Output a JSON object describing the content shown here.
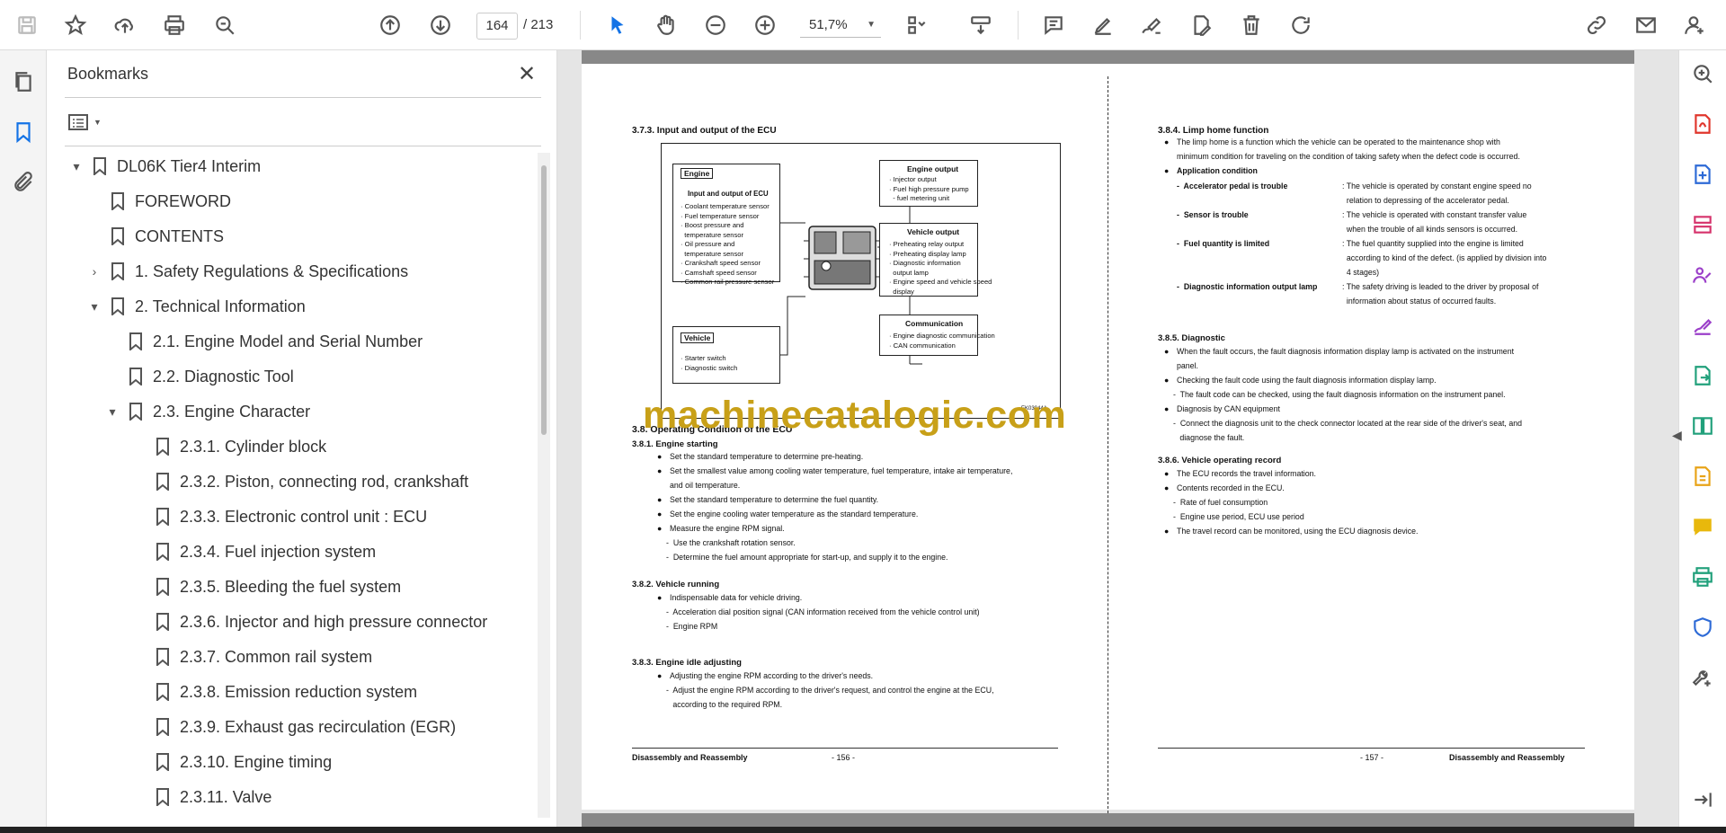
{
  "toolbar": {
    "current_page": "164",
    "total_pages": "/ 213",
    "zoom": "51,7%"
  },
  "bookmarks": {
    "title": "Bookmarks",
    "close_glyph": "✕",
    "items": [
      {
        "label": "DL06K Tier4 Interim",
        "level": 0,
        "toggle": "▾"
      },
      {
        "label": "FOREWORD",
        "level": 1,
        "toggle": ""
      },
      {
        "label": "CONTENTS",
        "level": 1,
        "toggle": ""
      },
      {
        "label": "1. Safety Regulations & Specifications",
        "level": 1,
        "toggle": "›"
      },
      {
        "label": "2. Technical Information",
        "level": 1,
        "toggle": "▾"
      },
      {
        "label": "2.1. Engine Model and Serial Number",
        "level": 2,
        "toggle": ""
      },
      {
        "label": "2.2. Diagnostic Tool",
        "level": 2,
        "toggle": ""
      },
      {
        "label": "2.3. Engine Character",
        "level": 2,
        "toggle": "▾"
      },
      {
        "label": "2.3.1. Cylinder block",
        "level": 3,
        "toggle": ""
      },
      {
        "label": "2.3.2. Piston, connecting rod, crankshaft",
        "level": 3,
        "toggle": ""
      },
      {
        "label": "2.3.3. Electronic control unit : ECU",
        "level": 3,
        "toggle": ""
      },
      {
        "label": "2.3.4. Fuel injection system",
        "level": 3,
        "toggle": ""
      },
      {
        "label": "2.3.5. Bleeding the fuel system",
        "level": 3,
        "toggle": ""
      },
      {
        "label": "2.3.6. Injector and high pressure connector",
        "level": 3,
        "toggle": ""
      },
      {
        "label": "2.3.7. Common rail system",
        "level": 3,
        "toggle": ""
      },
      {
        "label": "2.3.8. Emission reduction system",
        "level": 3,
        "toggle": ""
      },
      {
        "label": "2.3.9. Exhaust gas recirculation (EGR)",
        "level": 3,
        "toggle": ""
      },
      {
        "label": "2.3.10. Engine timing",
        "level": 3,
        "toggle": ""
      },
      {
        "label": "2.3.11. Valve",
        "level": 3,
        "toggle": ""
      }
    ]
  },
  "doc": {
    "watermark": "machinecatalogic.com",
    "left": {
      "heading_373": "3.7.3. Input and output of the ECU",
      "engine_tag": "Engine",
      "input_output_title": "Input and output of ECU",
      "engine_inputs": [
        "· Coolant temperature sensor",
        "· Fuel temperature sensor",
        "· Boost pressure and",
        "  temperature sensor",
        "· Oil pressure and",
        "  temperature sensor",
        "· Crankshaft speed sensor",
        "· Camshaft speed sensor",
        "· Common rail pressure sensor"
      ],
      "vehicle_tag": "Vehicle",
      "vehicle_inputs": [
        "· Starter switch",
        "· Diagnostic switch"
      ],
      "engine_output_title": "Engine output",
      "engine_outputs": [
        "· Injector output",
        "· Fuel high pressure pump",
        "  - fuel metering unit"
      ],
      "vehicle_output_title": "Vehicle output",
      "vehicle_outputs": [
        "· Preheating relay output",
        "· Preheating display lamp",
        "· Diagnostic information",
        "  output lamp",
        "· Engine speed and vehicle speed",
        "  display"
      ],
      "communication_title": "Communication",
      "communication_items": [
        "· Engine diagnostic communication",
        "· CAN communication"
      ],
      "fig_code": "EK03044A",
      "heading_38": "3.8. Operating Condition of the ECU",
      "heading_381": "3.8.1. Engine starting",
      "s381": [
        "Set the standard temperature to determine pre-heating.",
        "Set the smallest value among cooling water temperature, fuel temperature, intake air temperature,",
        "and oil temperature.",
        "Set the standard temperature to determine the fuel quantity.",
        "Set the engine cooling water temperature as the standard temperature.",
        "Measure the engine RPM signal.",
        "-  Use the crankshaft rotation sensor.",
        "-  Determine the fuel amount appropriate for start-up, and supply it to the engine."
      ],
      "heading_382": "3.8.2. Vehicle running",
      "s382": [
        "Indispensable data for vehicle driving.",
        "-  Acceleration dial position signal (CAN information received from the vehicle control unit)",
        "-  Engine RPM"
      ],
      "heading_383": "3.8.3. Engine idle adjusting",
      "s383": [
        "Adjusting the engine RPM according to the driver's needs.",
        "-  Adjust the engine RPM according to the driver's request, and control the engine at the ECU,",
        "   according to the required RPM."
      ],
      "footer_left": "Disassembly and Reassembly",
      "footer_page": "- 156 -"
    },
    "right": {
      "heading_384": "3.8.4. Limp home function",
      "s384_a": "The limp home is a function which the vehicle can be operated to the maintenance shop with",
      "s384_b": "minimum condition for traveling on the condition of taking safety when the defect code is occurred.",
      "app_cond": "Application condition",
      "conds": [
        {
          "k": "-  Accelerator pedal is trouble",
          "v1": ": The vehicle is operated by constant engine speed no",
          "v2": "  relation to depressing of the accelerator pedal.",
          "v3": ""
        },
        {
          "k": "-  Sensor is trouble",
          "v1": ": The vehicle is operated with constant transfer value",
          "v2": "  when the trouble of all kinds sensors is occurred.",
          "v3": ""
        },
        {
          "k": "-  Fuel quantity is limited",
          "v1": ": The fuel quantity supplied into the engine is limited",
          "v2": "  according to kind of the defect. (is applied by division into",
          "v3": "  4 stages)"
        },
        {
          "k": "-  Diagnostic information output lamp",
          "v1": ": The safety driving is leaded to the driver by proposal of",
          "v2": "  information about status of occurred faults.",
          "v3": ""
        }
      ],
      "heading_385": "3.8.5. Diagnostic",
      "s385": [
        "When the fault occurs, the fault diagnosis information display lamp is activated on the instrument",
        "panel.",
        "Checking the fault code using the fault diagnosis information display lamp.",
        "-  The fault code can be checked, using the fault diagnosis information on the instrument panel.",
        "Diagnosis by CAN equipment",
        "-  Connect the diagnosis unit to the check connector located at the rear side of the driver's seat, and",
        "   diagnose the fault."
      ],
      "heading_386": "3.8.6. Vehicle operating record",
      "s386": [
        "The ECU records the travel information.",
        "Contents recorded in the ECU.",
        "-  Rate of fuel consumption",
        "-  Engine use period, ECU use period",
        "The travel record can be monitored, using the ECU diagnosis device."
      ],
      "footer_page": "- 157 -",
      "footer_right": "Disassembly and Reassembly"
    }
  },
  "colors": {
    "accent_blue": "#1473e6",
    "watermark": "#c8a018"
  },
  "icons": {
    "toolbar": [
      "save-icon",
      "star-icon",
      "upload-icon",
      "print-icon",
      "find-icon",
      "page-up-icon",
      "page-down-icon",
      "select-arrow-icon",
      "hand-icon",
      "zoom-out-icon",
      "zoom-in-icon",
      "fit-page-icon",
      "scroll-mode-icon",
      "comment-icon",
      "highlight-icon",
      "sign-icon",
      "edit-icon",
      "delete-icon",
      "rotate-icon",
      "share-link-icon",
      "email-icon",
      "account-icon"
    ],
    "left_rail": [
      "pages-icon",
      "bookmark-icon",
      "attachment-icon"
    ],
    "right_rail": [
      "search-zoom-icon",
      "export-pdf-icon",
      "create-pdf-icon",
      "organize-pages-icon",
      "request-signature-icon",
      "fill-sign-icon",
      "export-icon",
      "compare-icon",
      "edit-pdf-icon",
      "comment-icon",
      "print-production-icon",
      "protect-icon",
      "more-tools-icon",
      "expand-panel-icon"
    ]
  }
}
